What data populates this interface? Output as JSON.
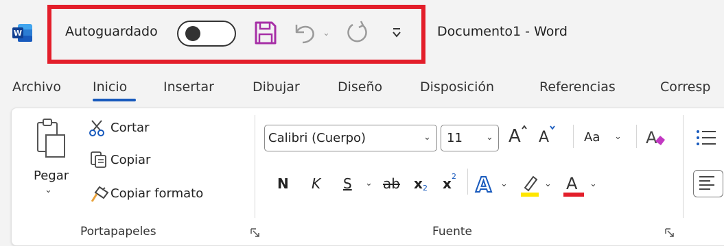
{
  "titlebar": {
    "app_icon_letter": "W",
    "autosave_label": "Autoguardado",
    "autosave_state": "off",
    "document_title": "Documento1  -  Word",
    "accent_color": "#185abd",
    "highlight_frame_color": "#e31e2a"
  },
  "tabs": [
    {
      "label": "Archivo"
    },
    {
      "label": "Inicio",
      "selected": true
    },
    {
      "label": "Insertar"
    },
    {
      "label": "Dibujar"
    },
    {
      "label": "Diseño"
    },
    {
      "label": "Disposición"
    },
    {
      "label": "Referencias"
    },
    {
      "label": "Corresp"
    }
  ],
  "clipboard": {
    "paste_label": "Pegar",
    "cut_label": "Cortar",
    "copy_label": "Copiar",
    "format_painter_label": "Copiar formato",
    "group_label": "Portapapeles"
  },
  "font": {
    "font_name": "Calibri (Cuerpo)",
    "font_size": "11",
    "case_label": "Aa",
    "bold": "N",
    "italic": "K",
    "underline": "S",
    "strikethrough": "ab",
    "subscript": "x",
    "superscript": "x",
    "group_label": "Fuente",
    "highlight_color": "#ffe600",
    "font_color": "#e31e2a"
  },
  "icons": [
    "word-app-icon",
    "save-icon",
    "undo-icon",
    "redo-icon",
    "customize-qat-icon",
    "paste-icon",
    "cut-icon",
    "copy-icon",
    "format-painter-icon",
    "grow-font-icon",
    "shrink-font-icon",
    "clear-format-icon",
    "text-effects-icon",
    "highlight-icon",
    "font-color-icon",
    "dialog-launcher-icon",
    "bullets-icon"
  ]
}
